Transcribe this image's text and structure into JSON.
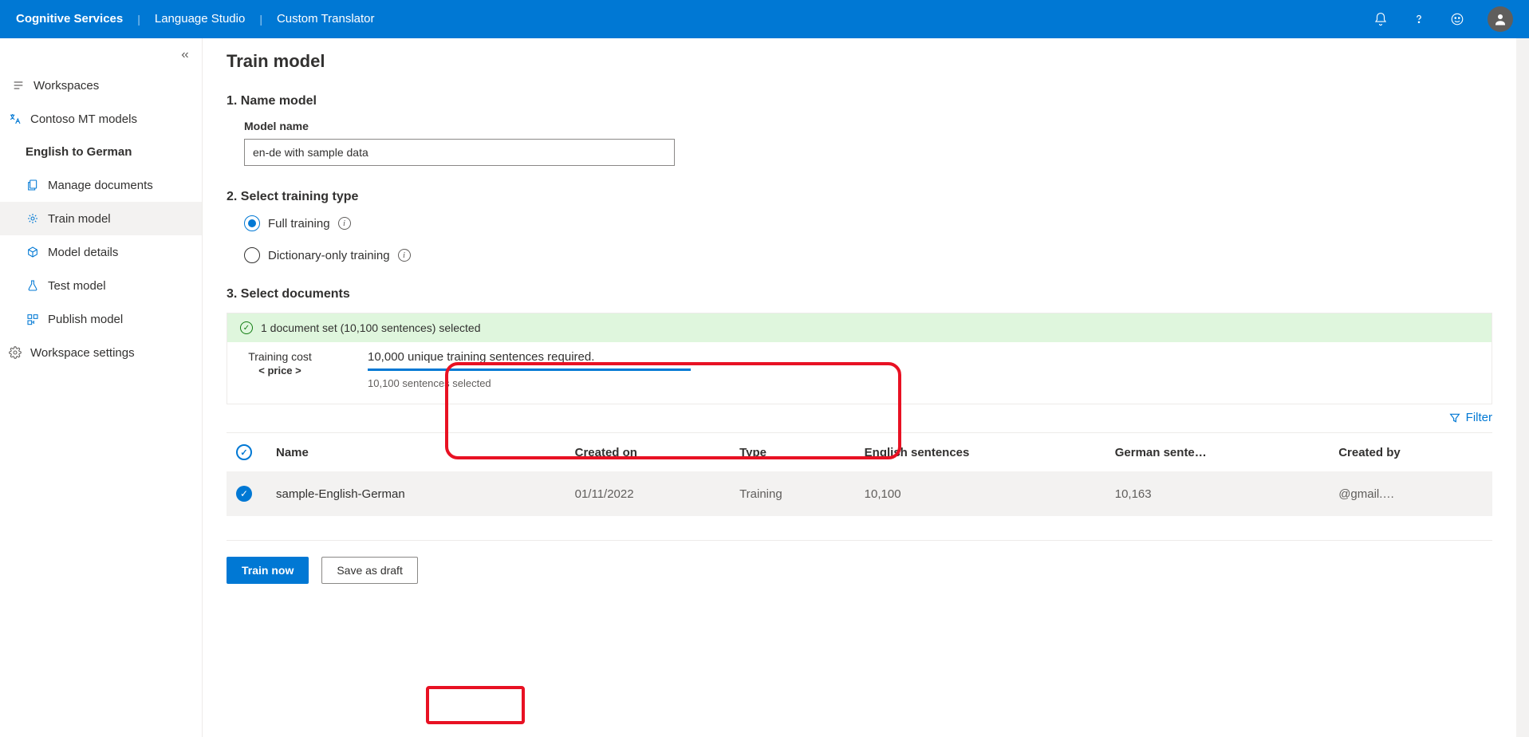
{
  "topbar": {
    "brand": "Cognitive Services",
    "section": "Language Studio",
    "page": "Custom Translator"
  },
  "sidebar": {
    "collapse_aria": "Collapse navigation",
    "workspaces": "Workspaces",
    "workspace": "Contoso MT models",
    "project": "English to German",
    "items": [
      {
        "id": "manage-documents",
        "label": "Manage documents"
      },
      {
        "id": "train-model",
        "label": "Train model"
      },
      {
        "id": "model-details",
        "label": "Model details"
      },
      {
        "id": "test-model",
        "label": "Test model"
      },
      {
        "id": "publish-model",
        "label": "Publish model"
      }
    ],
    "settings": "Workspace settings"
  },
  "main": {
    "title": "Train model",
    "step1": {
      "heading": "1. Name model",
      "label": "Model name",
      "value": "en-de with sample data"
    },
    "step2": {
      "heading": "2. Select training type",
      "option_full": "Full training",
      "option_dict": "Dictionary-only training"
    },
    "step3": {
      "heading": "3. Select documents",
      "banner": "1 document set (10,100 sentences) selected",
      "cost_label": "Training cost",
      "cost_price": "< price >",
      "required": "10,000 unique training sentences required.",
      "selected": "10,100 sentences selected"
    },
    "filter": "Filter",
    "table": {
      "headers": {
        "name": "Name",
        "created_on": "Created on",
        "type": "Type",
        "eng": "English sentences",
        "ger": "German sente…",
        "by": "Created by"
      },
      "rows": [
        {
          "name": "sample-English-German",
          "created_on": "01/11/2022",
          "type": "Training",
          "eng": "10,100",
          "ger": "10,163",
          "by": "@gmail.…"
        }
      ]
    },
    "actions": {
      "train": "Train now",
      "draft": "Save as draft"
    }
  }
}
